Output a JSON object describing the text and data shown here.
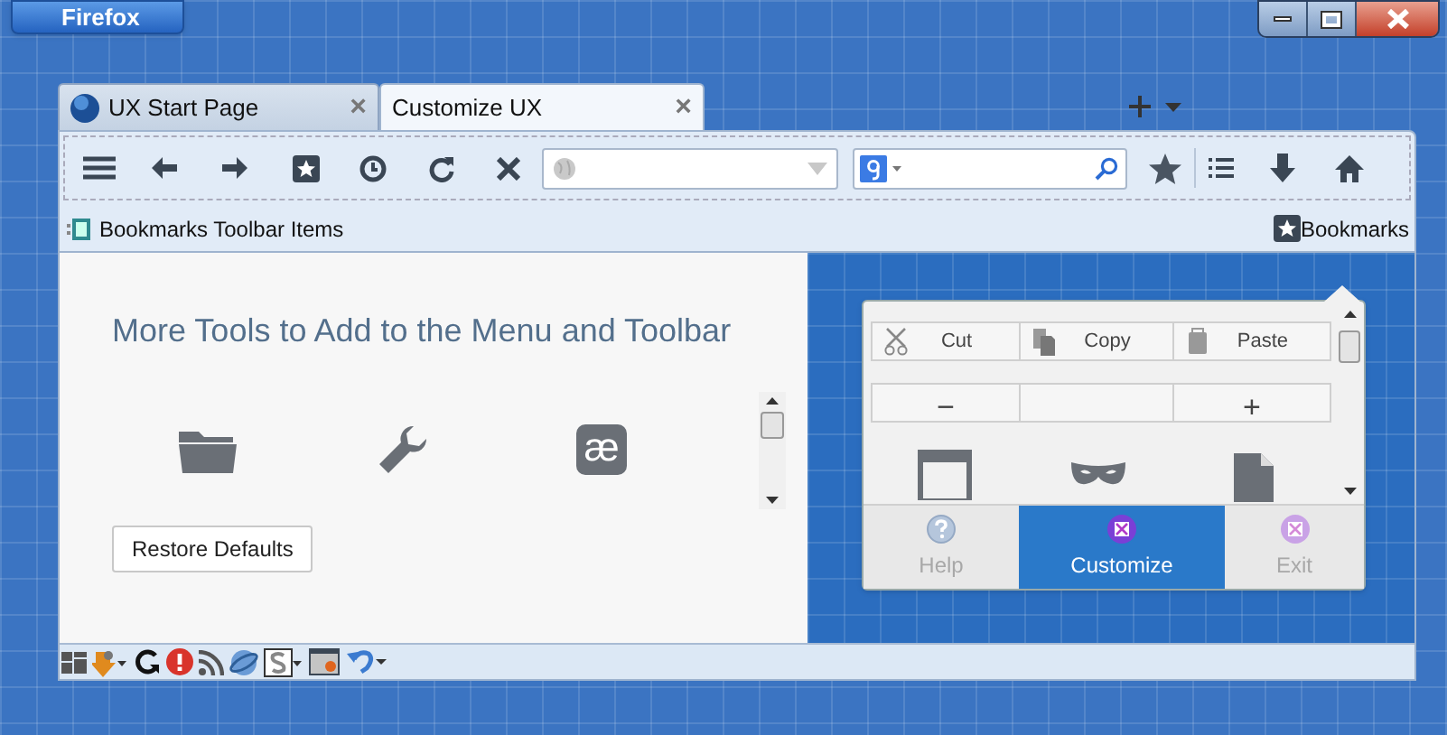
{
  "window": {
    "app_button": "Firefox"
  },
  "tabs": [
    {
      "label": "UX Start Page",
      "selected": false,
      "close": "×"
    },
    {
      "label": "Customize UX",
      "selected": true,
      "close": "×"
    }
  ],
  "bookmarks_toolbar": {
    "items_label": "Bookmarks Toolbar Items",
    "bookmarks_label": "Bookmarks"
  },
  "palette": {
    "title": "More Tools to Add to the Menu and Toolbar",
    "glyph_icon": "æ",
    "restore_button": "Restore Defaults"
  },
  "menu_panel": {
    "edit_buttons": [
      "Cut",
      "Copy",
      "Paste"
    ],
    "zoom_out": "−",
    "zoom_in": "+",
    "footer": [
      {
        "label": "Help",
        "selected": false
      },
      {
        "label": "Customize",
        "selected": true
      },
      {
        "label": "Exit",
        "selected": false
      }
    ]
  }
}
